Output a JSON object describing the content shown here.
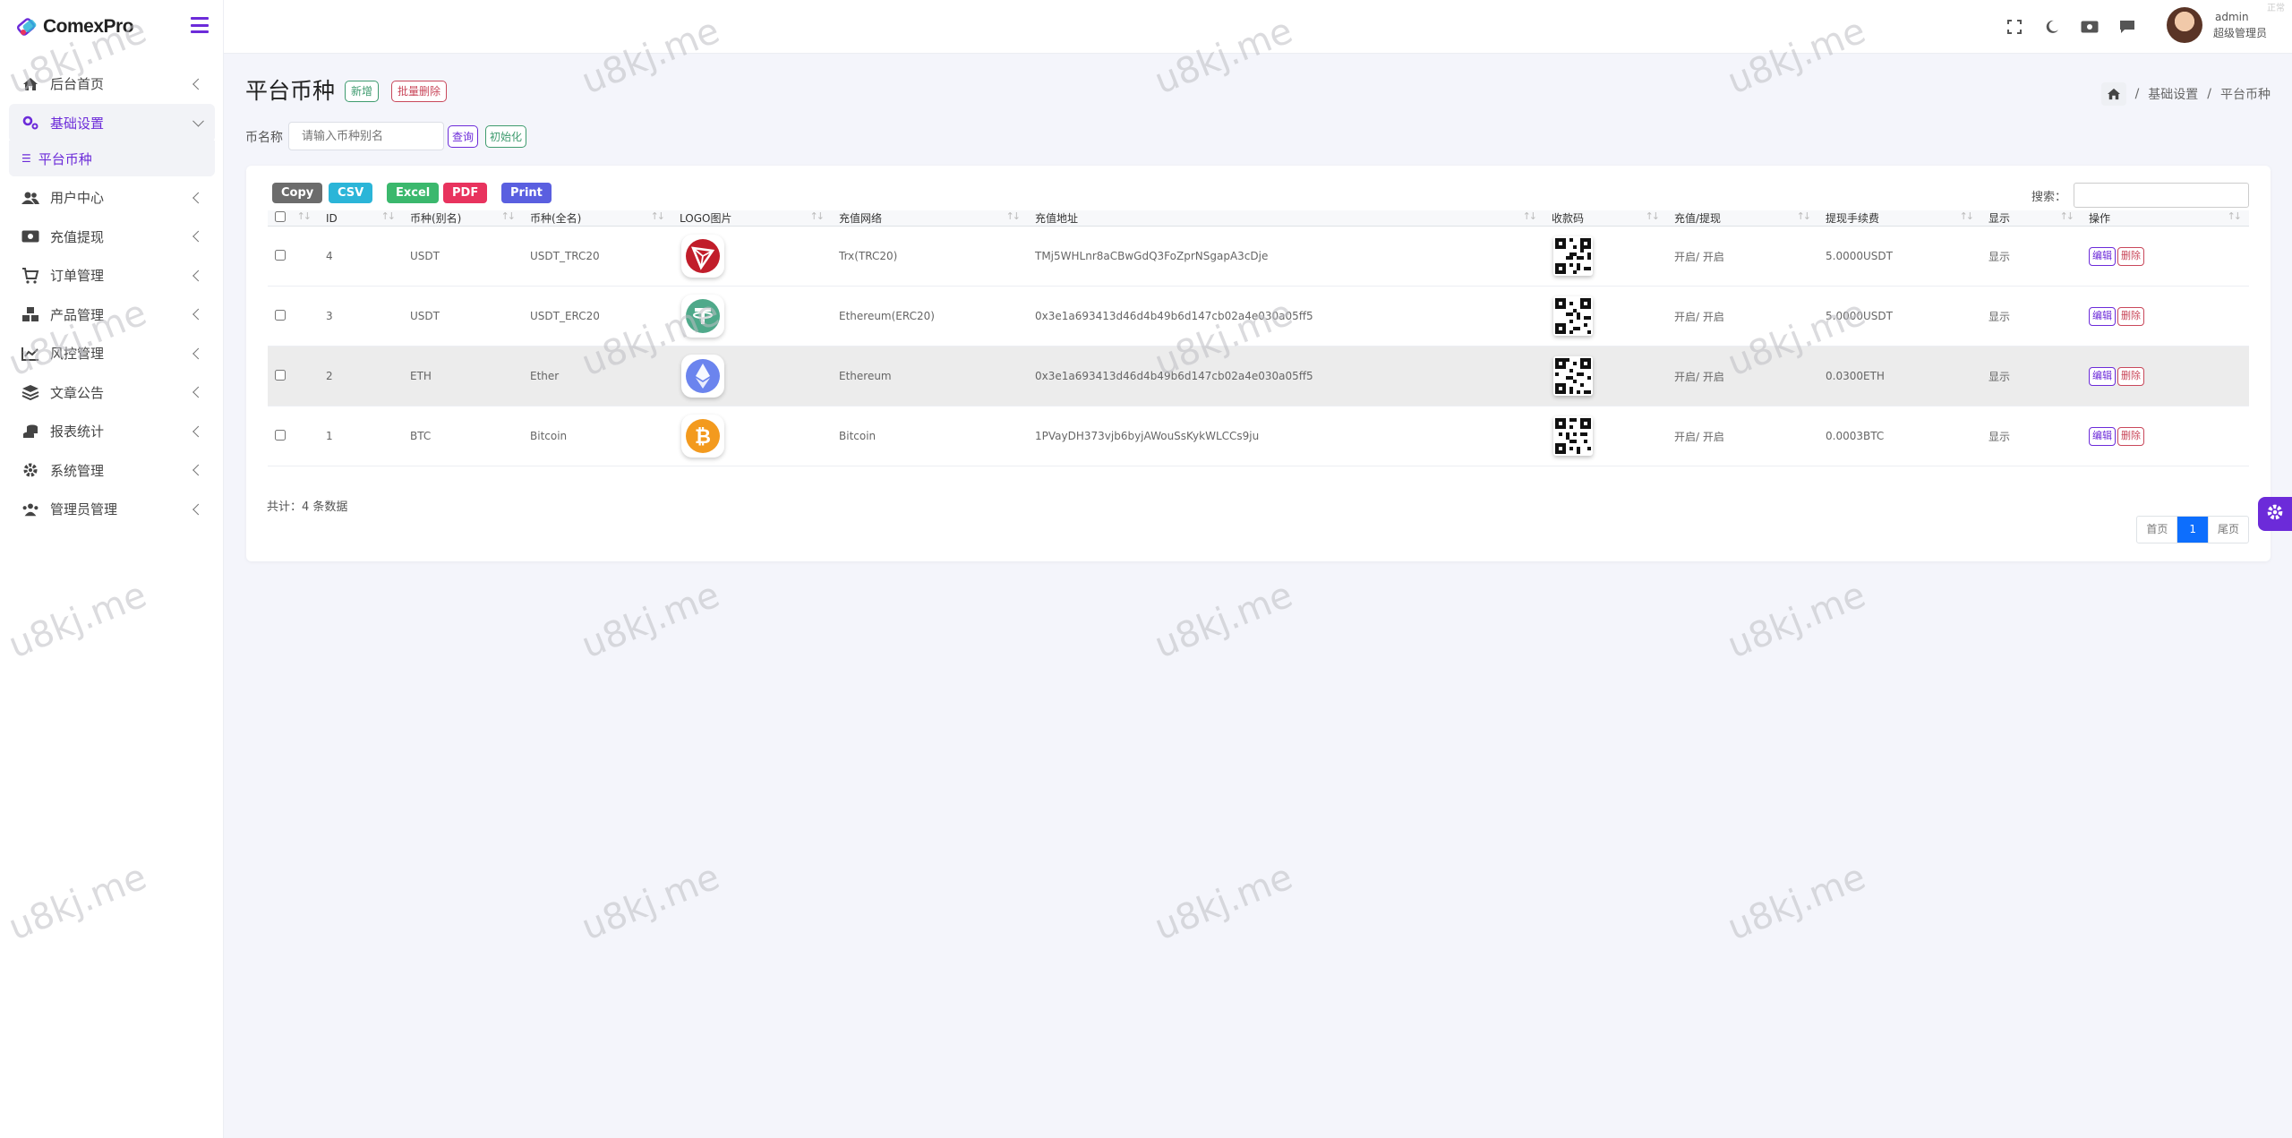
{
  "brand": {
    "name": "ComexPro"
  },
  "sidebar": {
    "items": [
      {
        "label": "后台首页",
        "icon": "home-icon"
      },
      {
        "label": "基础设置",
        "icon": "cogs-icon",
        "active": true,
        "children": [
          {
            "label": "平台币种"
          }
        ]
      },
      {
        "label": "用户中心",
        "icon": "users-icon"
      },
      {
        "label": "充值提现",
        "icon": "money-icon"
      },
      {
        "label": "订单管理",
        "icon": "cart-icon"
      },
      {
        "label": "产品管理",
        "icon": "cubes-icon"
      },
      {
        "label": "风控管理",
        "icon": "chart-line-icon"
      },
      {
        "label": "文章公告",
        "icon": "layers-icon"
      },
      {
        "label": "报表统计",
        "icon": "coins-icon"
      },
      {
        "label": "系统管理",
        "icon": "gear-icon"
      },
      {
        "label": "管理员管理",
        "icon": "user-group-icon"
      }
    ]
  },
  "topbar": {
    "user_name": "admin",
    "user_role": "超级管理员",
    "corner_mark": "正常"
  },
  "page": {
    "title": "平台币种",
    "new_label": "新增",
    "batch_delete_label": "批量删除",
    "breadcrumb": [
      "基础设置",
      "平台币种"
    ]
  },
  "filter": {
    "label": "币名称",
    "placeholder": "请输入币种别名",
    "query_label": "查询",
    "init_label": "初始化"
  },
  "table_tools": {
    "exports": [
      {
        "label": "Copy",
        "color": "#6c6c6c"
      },
      {
        "label": "CSV",
        "color": "#2bb5d8"
      },
      {
        "label": "Excel",
        "color": "#3bb86d"
      },
      {
        "label": "PDF",
        "color": "#e8335e"
      },
      {
        "label": "Print",
        "color": "#5a5fe0"
      }
    ],
    "search_label": "搜索："
  },
  "table": {
    "columns": [
      "ID",
      "币种(别名)",
      "币种(全名)",
      "LOGO图片",
      "充值网络",
      "充值地址",
      "收款码",
      "充值/提现",
      "提现手续费",
      "显示",
      "操作"
    ],
    "rows": [
      {
        "id": "4",
        "alias": "USDT",
        "full": "USDT_TRC20",
        "logo": "tron-icon",
        "network": "Trx(TRC20)",
        "address": "TMj5WHLnr8aCBwGdQ3FoZprNSgapA3cDje",
        "status": "开启/ 开启",
        "fee": "5.0000USDT",
        "show": "显示",
        "edit": "编辑",
        "del": "删除"
      },
      {
        "id": "3",
        "alias": "USDT",
        "full": "USDT_ERC20",
        "logo": "tether-icon",
        "network": "Ethereum(ERC20)",
        "address": "0x3e1a693413d46d4b49b6d147cb02a4e030a05ff5",
        "status": "开启/ 开启",
        "fee": "5.0000USDT",
        "show": "显示",
        "edit": "编辑",
        "del": "删除"
      },
      {
        "id": "2",
        "alias": "ETH",
        "full": "Ether",
        "logo": "ethereum-icon",
        "network": "Ethereum",
        "address": "0x3e1a693413d46d4b49b6d147cb02a4e030a05ff5",
        "status": "开启/ 开启",
        "fee": "0.0300ETH",
        "show": "显示",
        "edit": "编辑",
        "del": "删除"
      },
      {
        "id": "1",
        "alias": "BTC",
        "full": "Bitcoin",
        "logo": "bitcoin-icon",
        "network": "Bitcoin",
        "address": "1PVayDH373vjb6byjAWouSsKykWLCCs9ju",
        "status": "开启/ 开启",
        "fee": "0.0003BTC",
        "show": "显示",
        "edit": "编辑",
        "del": "删除"
      }
    ],
    "total_text": "共计：4 条数据"
  },
  "pagination": {
    "first": "首页",
    "current": "1",
    "last": "尾页"
  },
  "watermark": "u8kj.me",
  "colors": {
    "accent": "#6c2bd9",
    "success": "#3f9b6f",
    "danger": "#c9485b",
    "page_active": "#0d6efd"
  }
}
